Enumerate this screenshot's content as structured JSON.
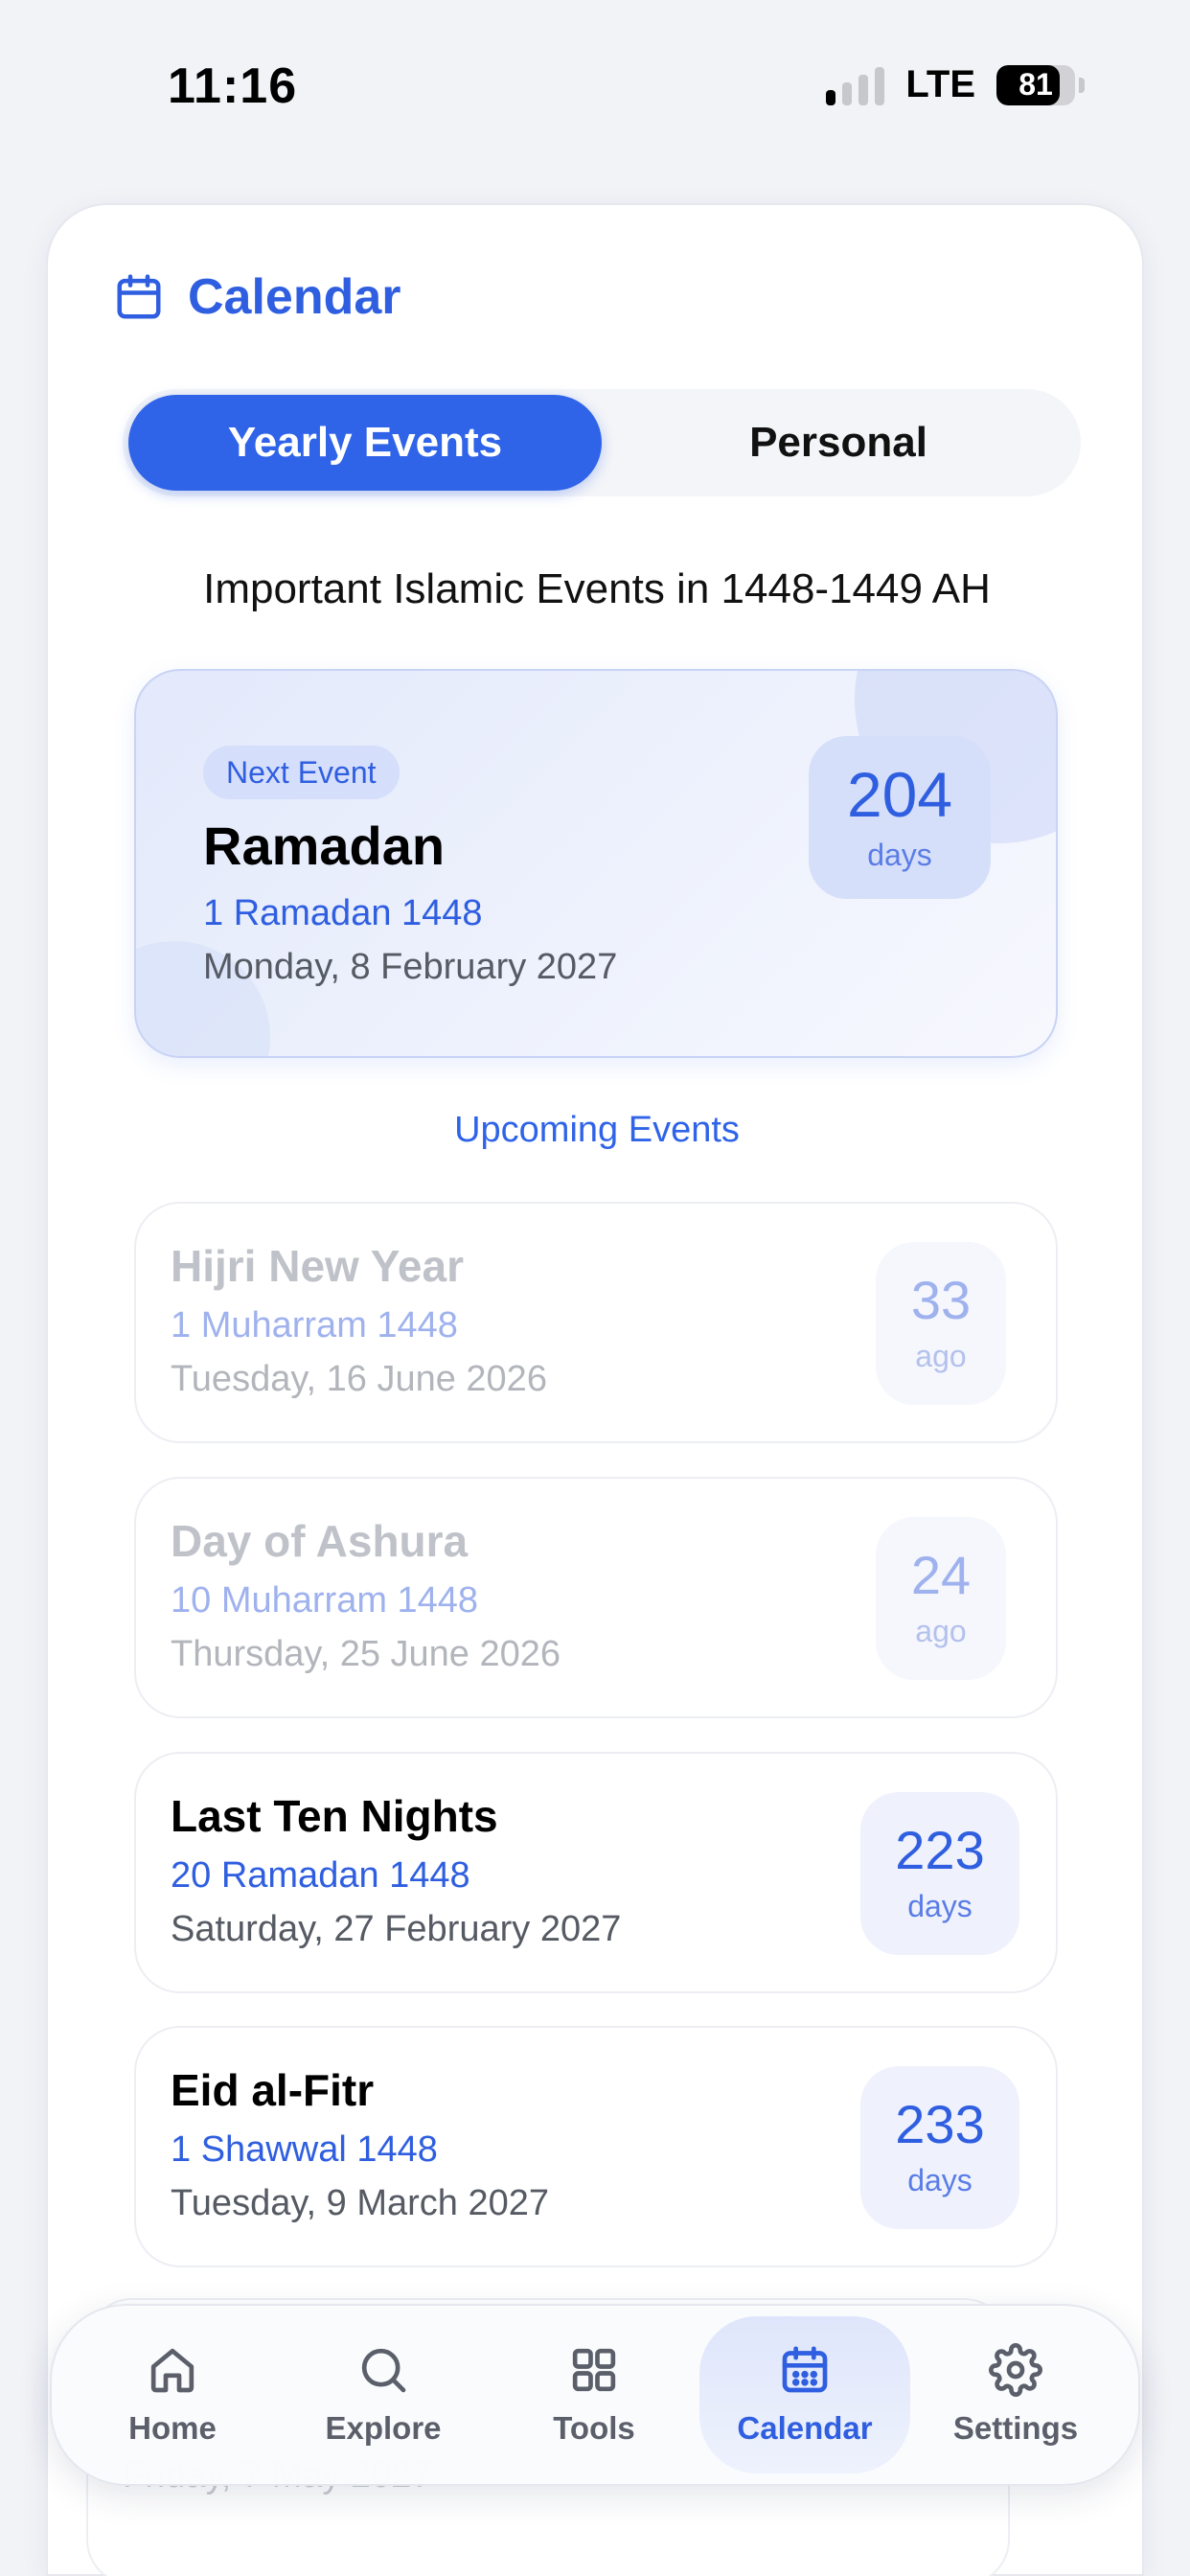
{
  "status": {
    "time": "11:16",
    "network": "LTE",
    "battery": "81",
    "battery_level": 0.81,
    "signal_bars_active": 1
  },
  "header": {
    "title": "Calendar",
    "icon": "calendar-icon",
    "accent": "#2f5fe0"
  },
  "segment": {
    "yearly": "Yearly Events",
    "personal": "Personal",
    "selected": "Yearly Events"
  },
  "subtitle": "Important Islamic Events in 1448-1449 AH",
  "featured": {
    "badge": "Next Event",
    "name": "Ramadan",
    "hijri": "1 Ramadan 1448",
    "gregorian": "Monday, 8 February 2027",
    "count": "204",
    "unit": "days"
  },
  "upcoming_label": "Upcoming Events",
  "events": [
    {
      "name": "Hijri New Year",
      "hijri": "1 Muharram 1448",
      "gregorian": "Tuesday, 16 June 2026",
      "count": "33",
      "unit": "ago",
      "past": true
    },
    {
      "name": "Day of Ashura",
      "hijri": "10 Muharram 1448",
      "gregorian": "Thursday, 25 June 2026",
      "count": "24",
      "unit": "ago",
      "past": true
    },
    {
      "name": "Last Ten Nights",
      "hijri": "20 Ramadan 1448",
      "gregorian": "Saturday, 27 February 2027",
      "count": "223",
      "unit": "days",
      "past": false
    },
    {
      "name": "Eid al-Fitr",
      "hijri": "1 Shawwal 1448",
      "gregorian": "Tuesday, 9 March 2027",
      "count": "233",
      "unit": "days",
      "past": false
    }
  ],
  "peek_text": "Friday, 7 May 2027",
  "tabs": [
    {
      "label": "Home",
      "icon": "home-icon"
    },
    {
      "label": "Explore",
      "icon": "search-icon"
    },
    {
      "label": "Tools",
      "icon": "grid-icon"
    },
    {
      "label": "Calendar",
      "icon": "calendar-icon",
      "active": true
    },
    {
      "label": "Settings",
      "icon": "gear-icon"
    }
  ]
}
